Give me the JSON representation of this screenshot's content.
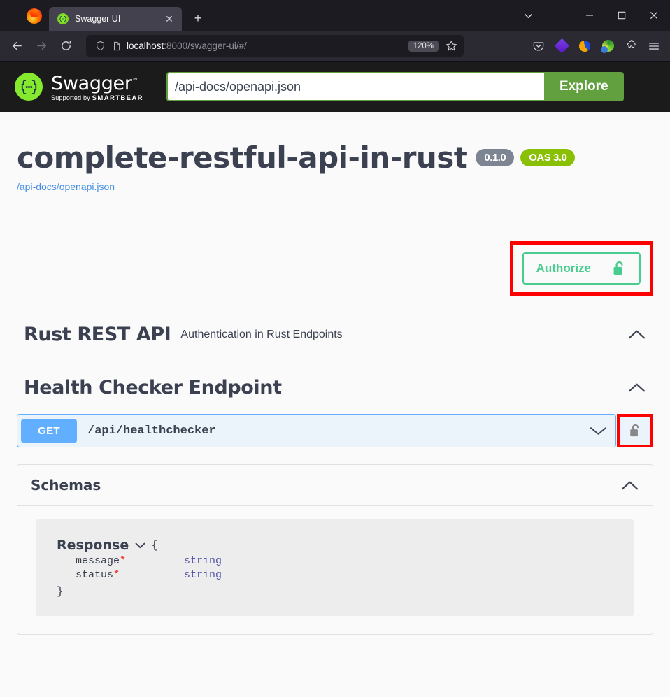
{
  "browser": {
    "tab": {
      "title": "Swagger UI",
      "favicon": "swagger-favicon",
      "close_label": "✕"
    },
    "newtab_label": "+",
    "window_controls": {
      "minimize": "−",
      "maximize": "□",
      "close": "✕"
    },
    "url": {
      "host": "localhost",
      "rest": ":8000/swagger-ui/#/"
    },
    "zoom_level": "120%",
    "nav": {
      "back": "back-arrow",
      "forward": "forward-arrow",
      "reload": "reload-arrow"
    }
  },
  "swagger": {
    "logo_text": "Swagger",
    "logo_tm": "™",
    "supported_prefix": "Supported by ",
    "supported_brand": "SMARTBEAR",
    "spec_url_value": "/api-docs/openapi.json",
    "spec_url_placeholder": "/api-docs/openapi.json",
    "explore_label": "Explore"
  },
  "info": {
    "title": "complete-restful-api-in-rust",
    "version_badge": "0.1.0",
    "oas_badge": "OAS 3.0",
    "spec_link": "/api-docs/openapi.json"
  },
  "authorize": {
    "label": "Authorize",
    "lock_icon": "unlock-icon",
    "highlight_color": "#ff0000",
    "accent_color": "#49cc90"
  },
  "tags": [
    {
      "name": "Rust REST API",
      "description": "Authentication in Rust Endpoints",
      "expanded": true,
      "chevron": "chevron-up-icon"
    },
    {
      "name": "Health Checker Endpoint",
      "description": "",
      "expanded": true,
      "chevron": "chevron-up-icon"
    }
  ],
  "operation": {
    "method": "GET",
    "method_color": "#61affe",
    "path": "/api/healthchecker",
    "expanded": false,
    "chevron": "chevron-down-icon",
    "lock_icon": "unlock-icon",
    "lock_highlighted": true
  },
  "schemas": {
    "title": "Schemas",
    "expanded": true,
    "chevron": "chevron-up-icon",
    "models": [
      {
        "name": "Response",
        "toggle": "chevron-down-icon",
        "open_brace": "{",
        "close_brace": "}",
        "properties": [
          {
            "name": "message",
            "required_mark": "*",
            "type": "string"
          },
          {
            "name": "status",
            "required_mark": "*",
            "type": "string"
          }
        ]
      }
    ]
  }
}
